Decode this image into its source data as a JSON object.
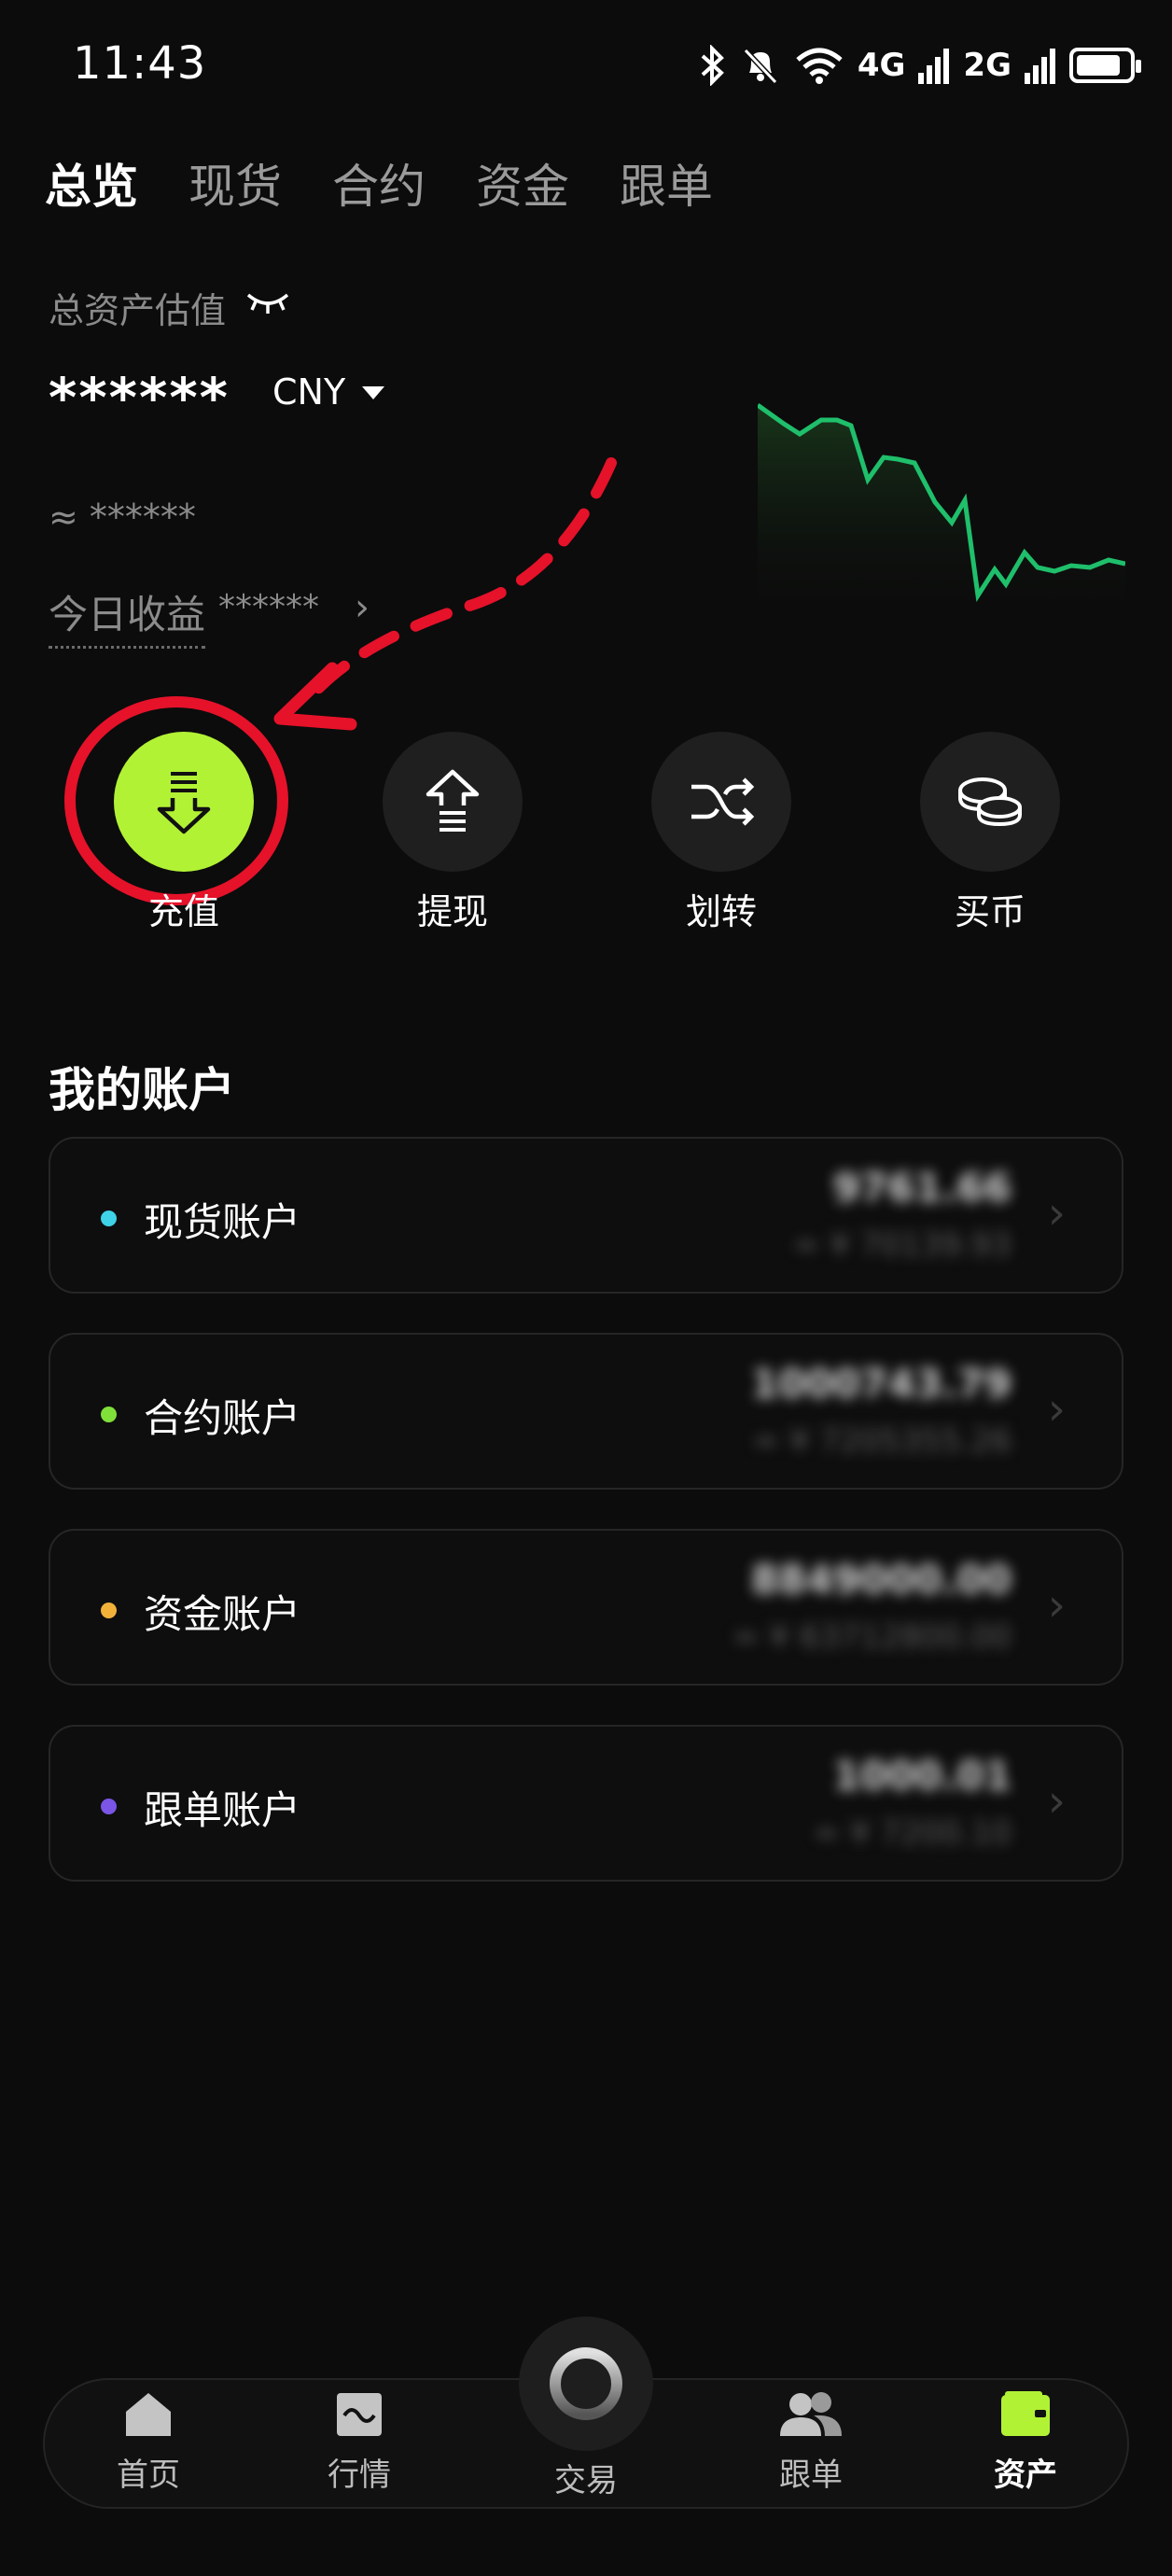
{
  "status_bar": {
    "time": "11:43",
    "network_4g": "4G",
    "network_2g": "2G",
    "battery_level": 0.85
  },
  "top_tabs": [
    {
      "label": "总览",
      "active": true
    },
    {
      "label": "现货",
      "active": false
    },
    {
      "label": "合约",
      "active": false
    },
    {
      "label": "资金",
      "active": false
    },
    {
      "label": "跟单",
      "active": false
    }
  ],
  "summary": {
    "label": "总资产估值",
    "value": "******",
    "currency": "CNY",
    "approx_value": "≈ ******",
    "today_label": "今日收益",
    "today_value": "******"
  },
  "actions": [
    {
      "label": "充值",
      "icon": "deposit-icon",
      "highlighted": true
    },
    {
      "label": "提现",
      "icon": "withdraw-icon"
    },
    {
      "label": "划转",
      "icon": "transfer-icon"
    },
    {
      "label": "买币",
      "icon": "buy-crypto-icon"
    }
  ],
  "accounts_title": "我的账户",
  "accounts": [
    {
      "name": "现货账户",
      "dot_color": "#3ed3e6",
      "amount": "9761.66",
      "sub": "≈ ¥ 70139.93"
    },
    {
      "name": "合约账户",
      "dot_color": "#7fe03a",
      "amount": "1000743.79",
      "sub": "≈ ¥ 7205355.26"
    },
    {
      "name": "资金账户",
      "dot_color": "#f2b23a",
      "amount": "8849000.00",
      "sub": "≈ ¥ 63712800.00"
    },
    {
      "name": "跟单账户",
      "dot_color": "#7a55e6",
      "amount": "1000.01",
      "sub": "≈ ¥ 7200.10"
    }
  ],
  "bottom_nav": [
    {
      "label": "首页",
      "icon": "home-icon"
    },
    {
      "label": "行情",
      "icon": "market-icon"
    },
    {
      "label": "交易",
      "icon": "trade-icon"
    },
    {
      "label": "跟单",
      "icon": "copy-trade-icon"
    },
    {
      "label": "资产",
      "icon": "wallet-icon",
      "active": true
    }
  ],
  "colors": {
    "accent": "#b2f235",
    "chart_line": "#1fbf6b",
    "annotation": "#e5122a"
  }
}
